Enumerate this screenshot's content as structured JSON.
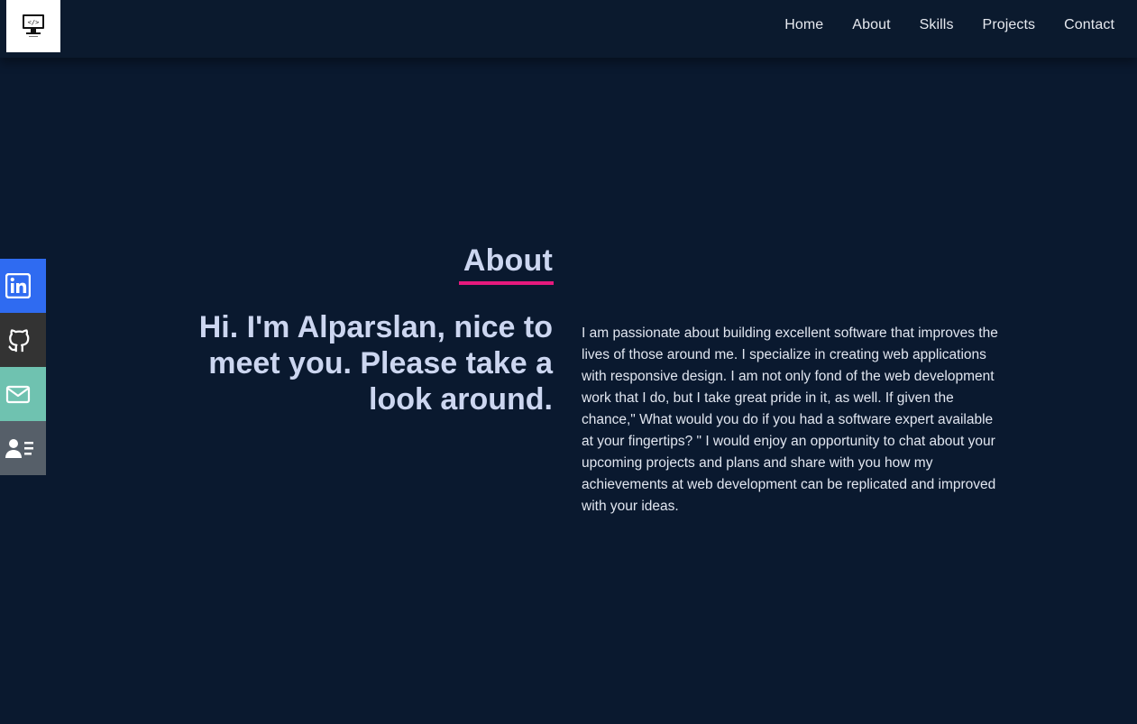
{
  "header": {
    "logo": {
      "icon": "monitor-code-icon"
    },
    "nav": [
      "Home",
      "About",
      "Skills",
      "Projects",
      "Contact"
    ]
  },
  "social": [
    {
      "name": "linkedin-icon",
      "color": "#2f6bf1"
    },
    {
      "name": "github-icon",
      "color": "#333333"
    },
    {
      "name": "mail-icon",
      "color": "#6fc2b0"
    },
    {
      "name": "resume-icon",
      "color": "#565f69"
    }
  ],
  "about": {
    "title": "About",
    "headline": "Hi. I'm Alparslan, nice to meet you. Please take a look around.",
    "bio": "I am passionate about building excellent software that improves the lives of those around me. I specialize in creating web applications with responsive design. I am not only fond of the web development work that I do, but I take great pride in it, as well. If given the chance,\" What would you do if you had a software expert available at your fingertips? \" I would enjoy an opportunity to chat about your upcoming projects and plans and share with you how my achievements at web development can be replicated and improved with your ideas."
  },
  "colors": {
    "background": "#0a192f",
    "accent": "#e6197d",
    "heading": "#ccd6f0"
  }
}
